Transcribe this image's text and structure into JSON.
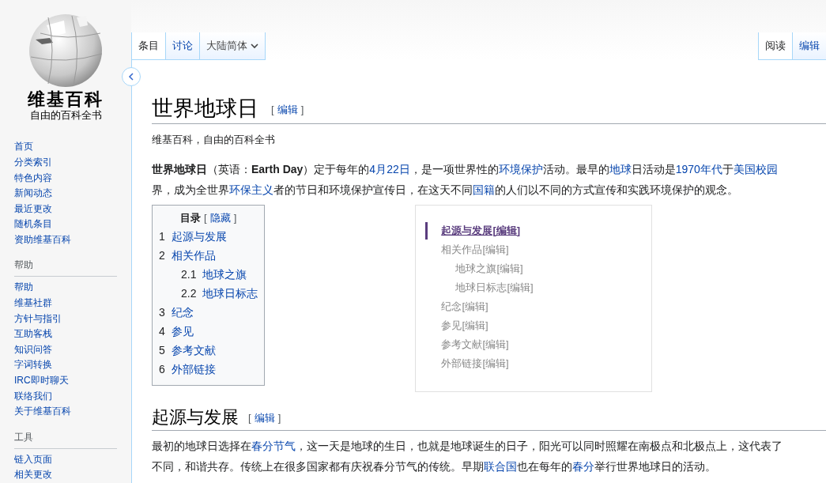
{
  "logo": {
    "title": "维基百科",
    "subtitle": "自由的百科全书"
  },
  "sidebar": {
    "sections": [
      {
        "items": [
          "首页",
          "分类索引",
          "特色内容",
          "新闻动态",
          "最近更改",
          "随机条目",
          "资助维基百科"
        ]
      },
      {
        "heading": "帮助",
        "items": [
          "帮助",
          "维基社群",
          "方针与指引",
          "互助客栈",
          "知识问答",
          "字词转换",
          "IRC即时聊天",
          "联络我们",
          "关于维基百科"
        ]
      },
      {
        "heading": "工具",
        "items": [
          "链入页面",
          "相关更改"
        ]
      }
    ]
  },
  "tabs_left": [
    {
      "label": "条目",
      "selected": true,
      "kind": "tab"
    },
    {
      "label": "讨论",
      "selected": false,
      "kind": "tab"
    },
    {
      "label": "大陆简体",
      "selected": false,
      "kind": "dropdown"
    }
  ],
  "tabs_right": [
    {
      "label": "阅读",
      "selected": true
    },
    {
      "label": "编辑",
      "selected": false
    }
  ],
  "article": {
    "title": "世界地球日",
    "title_edit": {
      "open": "[",
      "label": "编辑",
      "close": "]"
    },
    "tagline": "维基百科，自由的百科全书",
    "intro": [
      [
        {
          "text": "世界地球日",
          "bold": true
        },
        {
          "text": "（英语："
        },
        {
          "text": "Earth Day",
          "bold": true
        },
        {
          "text": "）定于每年的"
        },
        {
          "text": "4月22日",
          "link": true
        },
        {
          "text": "，是一项世界性的"
        },
        {
          "text": "环境保护",
          "link": true
        },
        {
          "text": "活动。最早的"
        },
        {
          "text": "地球",
          "link": true
        },
        {
          "text": "日活动是"
        },
        {
          "text": "1970年代",
          "link": true
        },
        {
          "text": "于"
        },
        {
          "text": "美国校园",
          "link": true
        }
      ],
      [
        {
          "text": "界，成为全世界"
        },
        {
          "text": "环保主义",
          "link": true
        },
        {
          "text": "者的节日和环境保护宣传日，在这天不同"
        },
        {
          "text": "国籍",
          "link": true
        },
        {
          "text": "的人们以不同的方式宣传和实践环境保护的观念。"
        }
      ]
    ],
    "toc": {
      "title": "目录",
      "toggle": {
        "open": "[",
        "label": "隐藏",
        "close": "]"
      },
      "items": [
        {
          "number": "1",
          "label": "起源与发展"
        },
        {
          "number": "2",
          "label": "相关作品",
          "children": [
            {
              "number": "2.1",
              "label": "地球之旗"
            },
            {
              "number": "2.2",
              "label": "地球日标志"
            }
          ]
        },
        {
          "number": "3",
          "label": "纪念"
        },
        {
          "number": "4",
          "label": "参见"
        },
        {
          "number": "5",
          "label": "参考文献"
        },
        {
          "number": "6",
          "label": "外部链接"
        }
      ]
    },
    "outline": [
      {
        "label": "起源与发展[编辑]",
        "selected": true
      },
      {
        "label": "相关作品[编辑]",
        "selected": false,
        "children": [
          {
            "label": "地球之旗[编辑]",
            "selected": false
          },
          {
            "label": "地球日标志[编辑]",
            "selected": false
          }
        ]
      },
      {
        "label": "纪念[编辑]",
        "selected": false
      },
      {
        "label": "参见[编辑]",
        "selected": false
      },
      {
        "label": "参考文献[编辑]",
        "selected": false
      },
      {
        "label": "外部链接[编辑]",
        "selected": false
      }
    ],
    "sections": [
      {
        "heading": "起源与发展",
        "edit": {
          "open": "[",
          "label": "编辑",
          "close": "]"
        },
        "paragraph": [
          [
            {
              "text": "最初的地球日选择在"
            },
            {
              "text": "春分节气",
              "link": true
            },
            {
              "text": "，这一天是地球的生日，也就是地球诞生的日子，阳光可以同时照耀在南极点和北极点上，这代表了"
            }
          ],
          [
            {
              "text": "不同，和谐共存。传统上在很多国家都有庆祝春分节气的传统。早期"
            },
            {
              "text": "联合国",
              "link": true
            },
            {
              "text": "也在每年的"
            },
            {
              "text": "春分",
              "link": true
            },
            {
              "text": "举行世界地球日的活动。"
            }
          ]
        ]
      }
    ]
  }
}
